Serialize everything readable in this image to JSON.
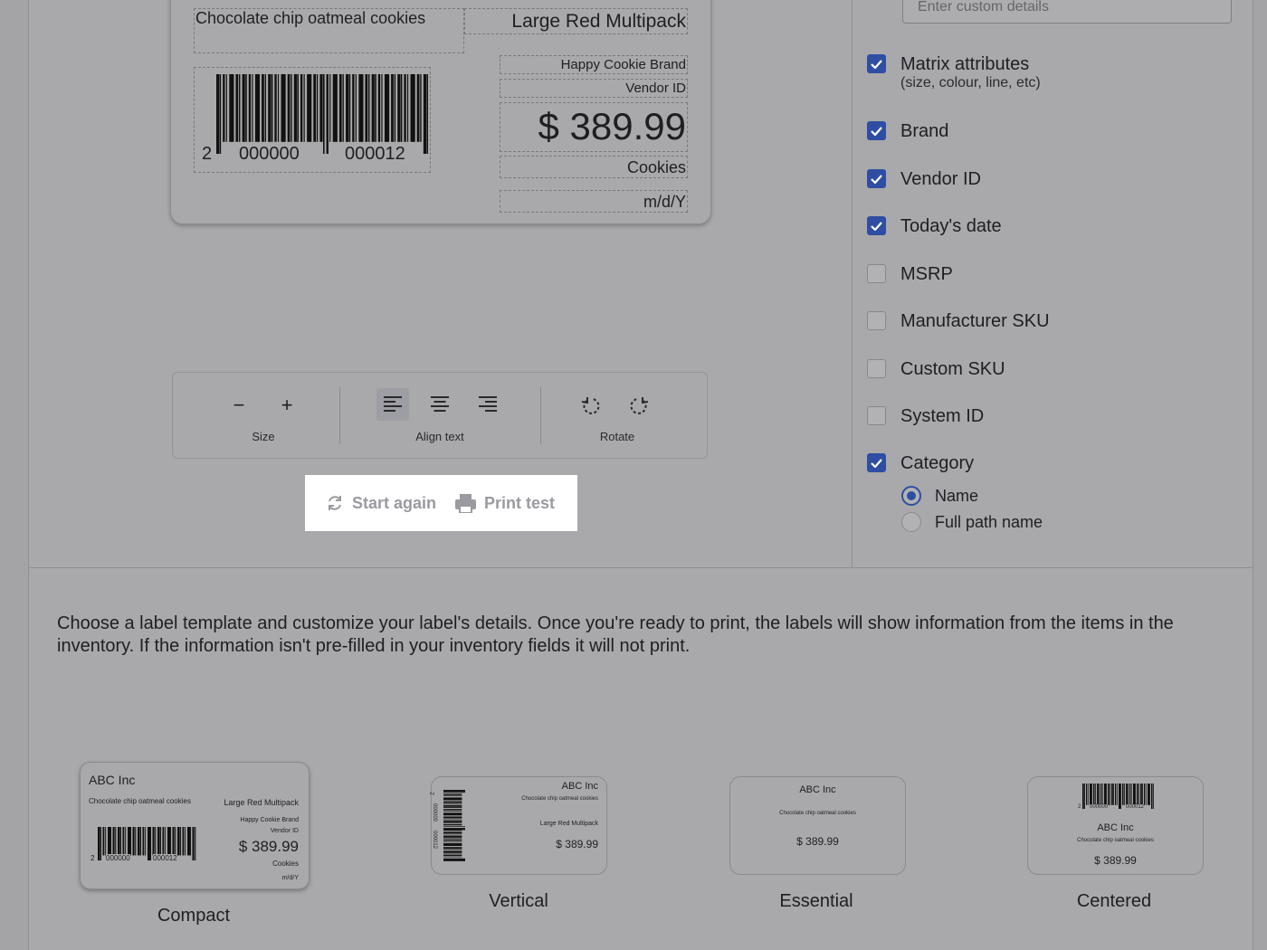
{
  "label_preview": {
    "description": "Chocolate chip oatmeal cookies",
    "matrix": "Large Red Multipack",
    "brand": "Happy Cookie Brand",
    "vendor_id": "Vendor ID",
    "price": "$ 389.99",
    "category": "Cookies",
    "date": "m/d/Y",
    "barcode_digits": [
      "2",
      "000000",
      "000012"
    ]
  },
  "toolbar": {
    "size_label": "Size",
    "align_label": "Align text",
    "rotate_label": "Rotate",
    "minus_glyph": "−",
    "plus_glyph": "+"
  },
  "actions": {
    "start_again": "Start again",
    "print_test": "Print test"
  },
  "options": {
    "custom_placeholder": "Enter custom details",
    "items": [
      {
        "label": "Matrix attributes",
        "sub": "(size, colour, line, etc)",
        "checked": true
      },
      {
        "label": "Brand",
        "checked": true
      },
      {
        "label": "Vendor ID",
        "checked": true
      },
      {
        "label": "Today's date",
        "checked": true
      },
      {
        "label": "MSRP",
        "checked": false
      },
      {
        "label": "Manufacturer SKU",
        "checked": false
      },
      {
        "label": "Custom SKU",
        "checked": false
      },
      {
        "label": "System ID",
        "checked": false
      },
      {
        "label": "Category",
        "checked": true
      }
    ],
    "category_modes": [
      {
        "label": "Name",
        "selected": true
      },
      {
        "label": "Full path name",
        "selected": false
      }
    ]
  },
  "description": "Choose a label template and customize your label's details. Once you're ready to print, the labels will show information from the items in the inventory. If the information isn't pre-filled in your inventory fields it will not print.",
  "templates": {
    "compact": {
      "name": "Compact",
      "company": "ABC Inc",
      "description": "Chocolate chip oatmeal cookies",
      "matrix": "Large Red Multipack",
      "brand": "Happy Cookie Brand",
      "vendor": "Vendor ID",
      "price": "$ 389.99",
      "category": "Cookies",
      "date": "m/d/Y",
      "digits": [
        "2",
        "000000",
        "000012"
      ]
    },
    "vertical": {
      "name": "Vertical",
      "company": "ABC Inc",
      "description": "Chocolate chip oatmeal cookies",
      "matrix": "Large Red Multipack",
      "price": "$ 389.99",
      "digits": [
        "2",
        "000000",
        "000012"
      ]
    },
    "essential": {
      "name": "Essential",
      "company": "ABC Inc",
      "description": "Chocolate chip oatmeal cookies",
      "price": "$ 389.99"
    },
    "centered": {
      "name": "Centered",
      "company": "ABC Inc",
      "description": "Chocolate chip oatmeal cookies",
      "price": "$ 389.99",
      "digits": [
        "2",
        "000000",
        "000012"
      ]
    }
  },
  "colors": {
    "accent": "#2f4ea3",
    "overlay_gray": "#a9a9ab",
    "highlight": "#ffffff"
  }
}
